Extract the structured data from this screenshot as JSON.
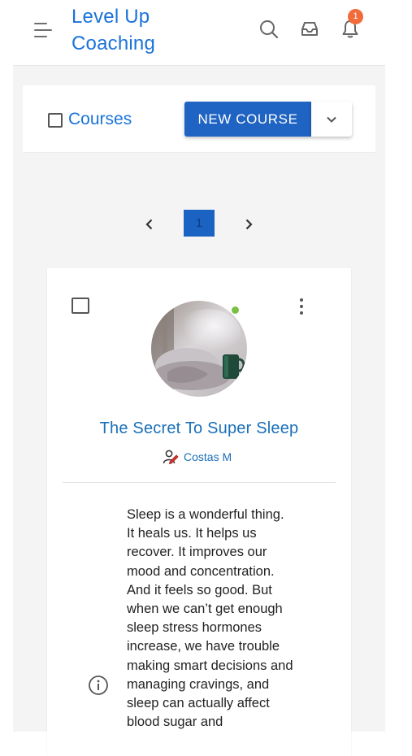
{
  "header": {
    "brand": "Level Up\nCoaching",
    "notification_count": "1"
  },
  "toolbar": {
    "courses_label": "Courses",
    "new_course_label": "NEW COURSE"
  },
  "pagination": {
    "current_page": "1"
  },
  "course": {
    "title": "The Secret To Super Sleep",
    "author": "Costas M",
    "status": "online",
    "description": "Sleep is a wonderful thing.\nIt heals us. It helps us\nrecover. It improves our\nmood and concentration.\nAnd it feels so good. But\nwhen we can’t get enough\nsleep stress hormones\nincrease, we have trouble\nmaking smart decisions and\nmanaging cravings, and\nsleep can actually affect\nblood sugar and"
  },
  "colors": {
    "brand": "#1a73d9",
    "primary_button": "#1f63c3",
    "badge": "#f26b3a",
    "online": "#7bc043"
  },
  "icons": [
    "menu-icon",
    "search-icon",
    "inbox-icon",
    "bell-icon",
    "chevron-down-icon",
    "chevron-left-icon",
    "chevron-right-icon",
    "more-vertical-icon",
    "author-icon",
    "info-icon"
  ]
}
